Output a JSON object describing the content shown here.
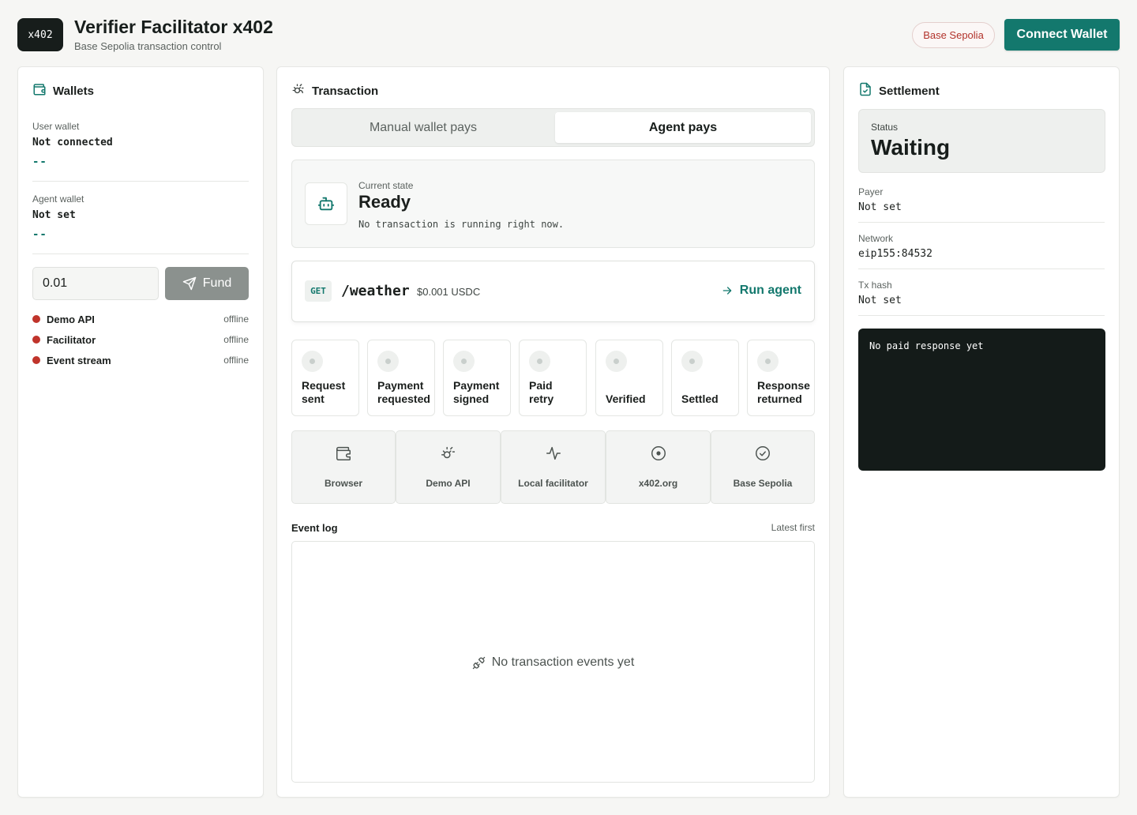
{
  "header": {
    "logo": "x402",
    "title": "Verifier Facilitator x402",
    "subtitle": "Base Sepolia transaction control",
    "network_pill": "Base Sepolia",
    "connect_label": "Connect Wallet"
  },
  "wallets": {
    "title": "Wallets",
    "user_label": "User wallet",
    "user_value": "Not connected",
    "user_dash": "--",
    "agent_label": "Agent wallet",
    "agent_value": "Not set",
    "agent_dash": "--",
    "amount": "0.01",
    "fund_label": "Fund",
    "services": [
      {
        "name": "Demo API",
        "status": "offline"
      },
      {
        "name": "Facilitator",
        "status": "offline"
      },
      {
        "name": "Event stream",
        "status": "offline"
      }
    ]
  },
  "transaction": {
    "title": "Transaction",
    "modes": [
      "Manual wallet pays",
      "Agent pays"
    ],
    "active_mode": "Agent pays",
    "state_label": "Current state",
    "state_value": "Ready",
    "state_desc": "No transaction is running right now.",
    "method": "GET",
    "path": "/weather",
    "price": "$0.001 USDC",
    "run_label": "Run agent",
    "steps": [
      [
        "Request",
        "sent"
      ],
      [
        "Payment",
        "requested"
      ],
      [
        "Payment",
        "signed"
      ],
      [
        "Paid",
        "retry"
      ],
      [
        "Verified",
        ""
      ],
      [
        "Settled",
        ""
      ],
      [
        "Response",
        "returned"
      ]
    ],
    "nodes": [
      "Browser",
      "Demo API",
      "Local facilitator",
      "x402.org",
      "Base Sepolia"
    ],
    "log_title": "Event log",
    "log_order": "Latest first",
    "log_empty": "No transaction events yet"
  },
  "settlement": {
    "title": "Settlement",
    "status_label": "Status",
    "status_value": "Waiting",
    "payer_label": "Payer",
    "payer_value": "Not set",
    "network_label": "Network",
    "network_value": "eip155:84532",
    "tx_label": "Tx hash",
    "tx_value": "Not set",
    "terminal_text": "No paid response yet"
  },
  "colors": {
    "accent": "#13786d",
    "offline": "#c0342b",
    "terminal_bg": "#141b19"
  }
}
